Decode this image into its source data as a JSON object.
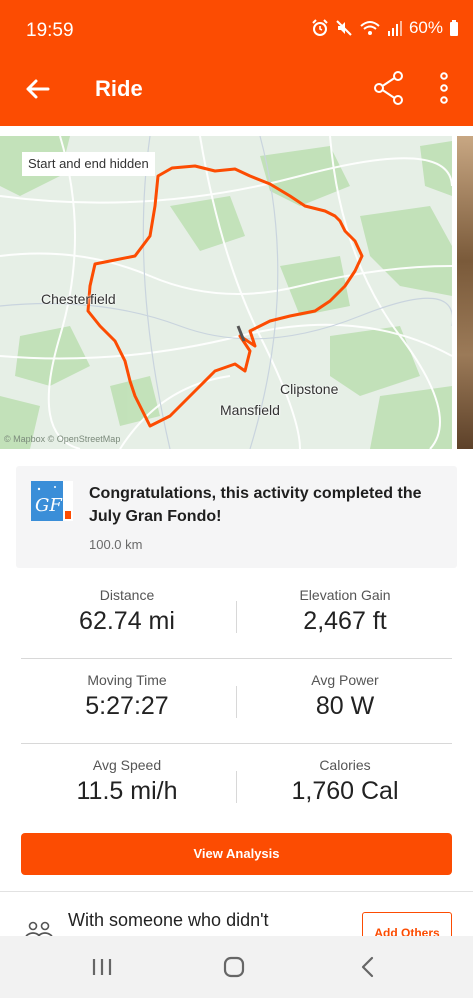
{
  "status_bar": {
    "time": "19:59",
    "battery": "60%",
    "icons": [
      "alarm-icon",
      "mute-icon",
      "wifi-icon",
      "signal-icon",
      "battery-icon"
    ]
  },
  "app_bar": {
    "title": "Ride",
    "icons": [
      "back-arrow-icon",
      "share-icon",
      "more-vertical-icon"
    ]
  },
  "map": {
    "privacy_label": "Start and end hidden",
    "places": {
      "chesterfield": "Chesterfield",
      "clipstone": "Clipstone",
      "mansfield": "Mansfield"
    },
    "attribution": "© Mapbox © OpenStreetMap",
    "route_color": "#fc4c02"
  },
  "challenge": {
    "title": "Congratulations, this activity completed the July Gran Fondo!",
    "distance": "100.0 km",
    "badge_icon": "gran-fondo-badge-icon"
  },
  "stats": [
    {
      "label": "Distance",
      "value": "62.74 mi"
    },
    {
      "label": "Elevation Gain",
      "value": "2,467 ft"
    },
    {
      "label": "Moving Time",
      "value": "5:27:27"
    },
    {
      "label": "Avg Power",
      "value": "80 W"
    },
    {
      "label": "Avg Speed",
      "value": "11.5 mi/h"
    },
    {
      "label": "Calories",
      "value": "1,760 Cal"
    }
  ],
  "actions": {
    "view_analysis": "View Analysis"
  },
  "group": {
    "text": "With someone who didn't",
    "add_others": "Add Others",
    "icon": "people-icon"
  },
  "nav": {
    "icons": [
      "recent-apps-icon",
      "home-icon",
      "back-icon"
    ]
  },
  "colors": {
    "brand": "#fc4c02",
    "card_bg": "#f5f5f6"
  }
}
